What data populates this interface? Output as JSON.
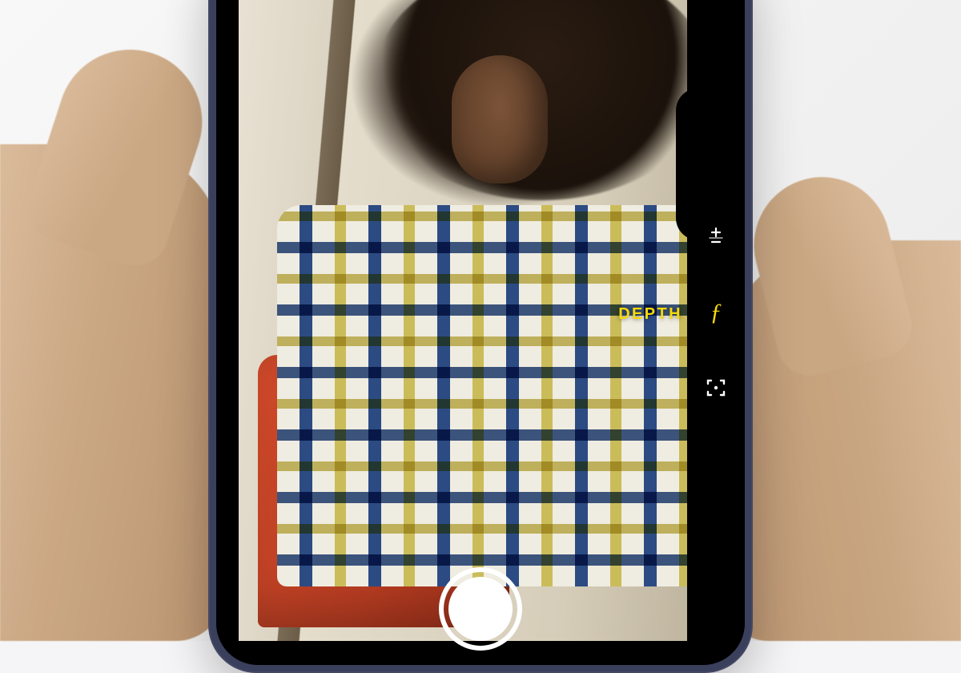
{
  "camera_ui": {
    "mode_label": "DEPTH",
    "controls": {
      "exposure": "exposure-icon",
      "depth": "aperture-f-icon",
      "frame": "frame-focus-icon"
    },
    "accent_color": "#f5d90a"
  }
}
